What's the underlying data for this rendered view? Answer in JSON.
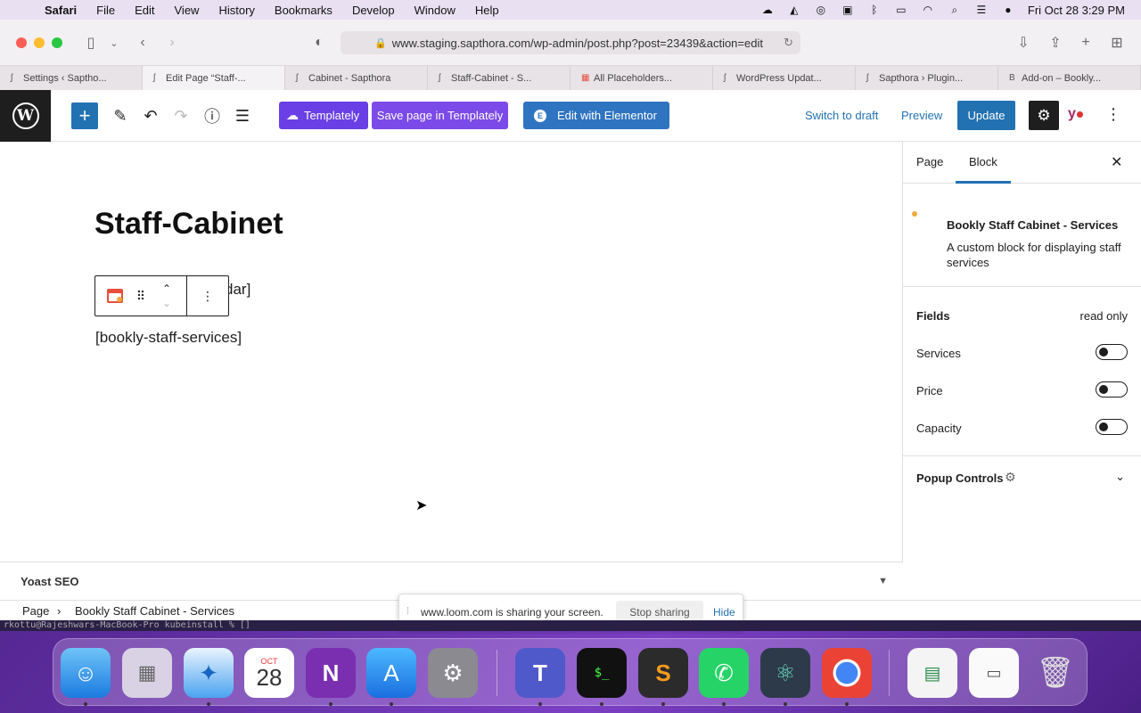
{
  "menubar": {
    "app": "Safari",
    "items": [
      "File",
      "Edit",
      "View",
      "History",
      "Bookmarks",
      "Develop",
      "Window",
      "Help"
    ],
    "datetime": "Fri Oct 28  3:29 PM"
  },
  "browser": {
    "url": "www.staging.sapthora.com/wp-admin/post.php?post=23439&action=edit",
    "tabs": [
      {
        "label": "Settings ‹ Saptho..."
      },
      {
        "label": "Edit Page “Staff-..."
      },
      {
        "label": "Cabinet - Sapthora"
      },
      {
        "label": "Staff-Cabinet - S..."
      },
      {
        "label": "All Placeholders..."
      },
      {
        "label": "WordPress Updat..."
      },
      {
        "label": "Sapthora › Plugin..."
      },
      {
        "label": "Add-on – Bookly..."
      }
    ]
  },
  "editor": {
    "templately_label": "Templately",
    "save_templately_label": "Save page in Templately",
    "elementor_label": "Edit with Elementor",
    "switch_draft_label": "Switch to draft",
    "preview_label": "Preview",
    "update_label": "Update",
    "page_title": "Staff-Cabinet",
    "para1_visible": "dar]",
    "para2": "[bookly-staff-services]"
  },
  "sidebar": {
    "tab_page": "Page",
    "tab_block": "Block",
    "block_title": "Bookly Staff Cabinet - Services",
    "block_desc": "A custom block for displaying staff services",
    "fields_header": "Fields",
    "fields_note": "read only",
    "fields": [
      {
        "label": "Services"
      },
      {
        "label": "Price"
      },
      {
        "label": "Capacity"
      }
    ],
    "popup_controls": "Popup Controls"
  },
  "footer": {
    "yoast_label": "Yoast SEO",
    "crumb_page": "Page",
    "crumb_block": "Bookly Staff Cabinet - Services"
  },
  "loom": {
    "message": "www.loom.com is sharing your screen.",
    "stop_label": "Stop sharing",
    "hide_label": "Hide"
  },
  "terminal_text": "rkottu@Rajeshwars-MacBook-Pro kubeinstall % []",
  "dock": {
    "calendar_month": "OCT",
    "calendar_day": "28"
  },
  "colors": {
    "wp_blue": "#2271b1",
    "templately_purple": "#6a3fe5",
    "elementor_blue": "#2f74c0"
  }
}
